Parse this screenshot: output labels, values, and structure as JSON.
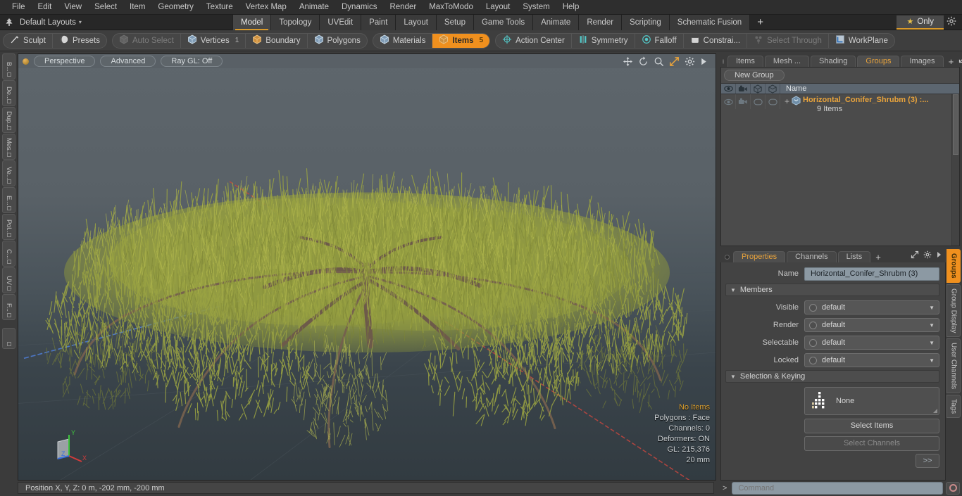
{
  "menubar": {
    "items": [
      "File",
      "Edit",
      "View",
      "Select",
      "Item",
      "Geometry",
      "Texture",
      "Vertex Map",
      "Animate",
      "Dynamics",
      "Render",
      "MaxToModo",
      "Layout",
      "System",
      "Help"
    ]
  },
  "layoutbar": {
    "tree_icon": "tree-icon",
    "layout_label": "Default Layouts",
    "caret": "▾",
    "tabs": [
      {
        "label": "Model",
        "active": true
      },
      {
        "label": "Topology",
        "active": false
      },
      {
        "label": "UVEdit",
        "active": false
      },
      {
        "label": "Paint",
        "active": false
      },
      {
        "label": "Layout",
        "active": false
      },
      {
        "label": "Setup",
        "active": false
      },
      {
        "label": "Game Tools",
        "active": false
      },
      {
        "label": "Animate",
        "active": false
      },
      {
        "label": "Render",
        "active": false
      },
      {
        "label": "Scripting",
        "active": false
      },
      {
        "label": "Schematic Fusion",
        "active": false
      }
    ],
    "add_tab": "+",
    "only_label": "Only",
    "star": "★",
    "gear": "gear-icon"
  },
  "toolbar": {
    "groups": [
      {
        "buttons": [
          {
            "label": "Sculpt",
            "icon": "brush-icon",
            "state": "normal"
          },
          {
            "label": "Presets",
            "icon": "sphere-icon",
            "state": "normal"
          }
        ]
      },
      {
        "buttons": [
          {
            "label": "Auto Select",
            "icon": "cube-gray-icon",
            "state": "disabled"
          },
          {
            "label": "Vertices",
            "icon": "cube-blue-icon",
            "state": "normal",
            "num": "1"
          },
          {
            "label": "Boundary",
            "icon": "cube-orange-icon",
            "state": "normal"
          },
          {
            "label": "Polygons",
            "icon": "cube-blue-icon",
            "state": "normal"
          }
        ]
      },
      {
        "buttons": [
          {
            "label": "Materials",
            "icon": "cube-blue-icon",
            "state": "normal"
          },
          {
            "label": "Items",
            "icon": "cube-orange-icon",
            "state": "active",
            "num": "5"
          }
        ]
      },
      {
        "buttons": [
          {
            "label": "Action Center",
            "icon": "target-icon",
            "state": "normal"
          },
          {
            "label": "Symmetry",
            "icon": "symmetry-icon",
            "state": "normal"
          },
          {
            "label": "Falloff",
            "icon": "falloff-icon",
            "state": "normal"
          },
          {
            "label": "Constrai...",
            "icon": "constraint-icon",
            "state": "normal"
          },
          {
            "label": "Select Through",
            "icon": "select-through-icon",
            "state": "disabled"
          },
          {
            "label": "WorkPlane",
            "icon": "workplane-icon",
            "state": "normal"
          }
        ]
      }
    ]
  },
  "leftstrip": {
    "tabs": [
      "B...",
      "De...",
      "Dup...",
      "Mes...",
      "Ve...",
      "E...",
      "Pol...",
      "C...",
      "UV",
      "F..."
    ]
  },
  "viewport": {
    "header": {
      "buttons": [
        "Perspective",
        "Advanced",
        "Ray GL: Off"
      ],
      "icons": [
        "move-icon",
        "rotate-icon",
        "zoom-icon",
        "fit-icon",
        "gear-icon",
        "play-icon"
      ]
    },
    "stats": {
      "selection": "No Items",
      "polygons": "Polygons : Face",
      "channels": "Channels: 0",
      "deformers": "Deformers: ON",
      "gl": "GL: 215,376",
      "scale": "20 mm"
    },
    "gizmo": {
      "x": "X",
      "y": "Y",
      "z": "Z"
    }
  },
  "statusbar": {
    "position": "Position X, Y, Z:   0 m, -202 mm, -200 mm"
  },
  "rightpanel": {
    "top_tabs": [
      {
        "label": "Items",
        "active": false
      },
      {
        "label": "Mesh ...",
        "active": false
      },
      {
        "label": "Shading",
        "active": false
      },
      {
        "label": "Groups",
        "active": true
      },
      {
        "label": "Images",
        "active": false
      }
    ],
    "top_tabs_add": "+",
    "new_group_button": "New Group",
    "grid": {
      "columns": [
        "eye-icon",
        "render-icon",
        "selectable-cube-icon",
        "lock-cube-icon"
      ],
      "name_header": "Name",
      "rows": [
        {
          "expander": "+",
          "name": "Horizontal_Conifer_Shrubm",
          "count": "(3) :...",
          "sub": "9 Items"
        }
      ]
    },
    "prop_tabs": [
      {
        "label": "Properties",
        "active": true
      },
      {
        "label": "Channels",
        "active": false
      },
      {
        "label": "Lists",
        "active": false
      }
    ],
    "prop_tabs_add": "+",
    "properties": {
      "name_label": "Name",
      "name_value": "Horizontal_Conifer_Shrubm (3)",
      "members_section": "Members",
      "members": [
        {
          "label": "Visible",
          "value": "default"
        },
        {
          "label": "Render",
          "value": "default"
        },
        {
          "label": "Selectable",
          "value": "default"
        },
        {
          "label": "Locked",
          "value": "default"
        }
      ],
      "selection_section": "Selection & Keying",
      "none_value": "None",
      "select_items": "Select Items",
      "select_channels": "Select Channels",
      "expand_button": ">>"
    },
    "side_tabs": [
      {
        "label": "Groups",
        "active": true
      },
      {
        "label": "Group Display",
        "active": false
      },
      {
        "label": "User Channels",
        "active": false
      },
      {
        "label": "Tags",
        "active": false
      }
    ],
    "command": {
      "arrow": ">",
      "placeholder": "Command",
      "record": "record-icon"
    }
  },
  "colors": {
    "accent_orange": "#f0901e",
    "tab_orange": "#d99a2b",
    "field_blue": "#8c99a3",
    "viewport_top": "#5e666c",
    "viewport_bottom": "#323b41",
    "foliage": "#9aa342",
    "branch": "#6d5a4a"
  }
}
